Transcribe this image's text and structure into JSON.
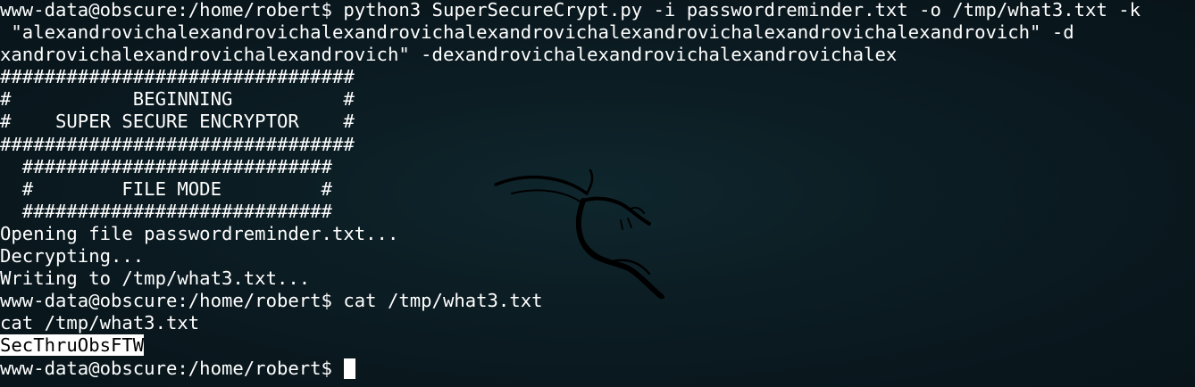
{
  "terminal": {
    "lines": [
      "www-data@obscure:/home/robert$ python3 SuperSecureCrypt.py -i passwordreminder.txt -o /tmp/what3.txt -k",
      " \"alexandrovichalexandrovichalexandrovichalexandrovichalexandrovichalexandrovichalexandrovich\" -d",
      "xandrovichalexandrovichalexandrovich\" -dexandrovichalexandrovichalexandrovichalex",
      "################################",
      "#           BEGINNING          #",
      "#    SUPER SECURE ENCRYPTOR    #",
      "################################",
      "  ############################",
      "  #        FILE MODE         #",
      "  ############################",
      "Opening file passwordreminder.txt...",
      "Decrypting...",
      "Writing to /tmp/what3.txt...",
      "www-data@obscure:/home/robert$ cat /tmp/what3.txt",
      "cat /tmp/what3.txt"
    ],
    "highlighted_output": "SecThruObsFTW",
    "prompt": "www-data@obscure:/home/robert$ ",
    "cursor_icon": "block-cursor",
    "background_logo": "kali-dragon-icon",
    "colors": {
      "background": "#0b1c22",
      "text": "#ffffff",
      "highlight_bg": "#ffffff",
      "highlight_fg": "#000000",
      "logo": "#000000"
    }
  }
}
